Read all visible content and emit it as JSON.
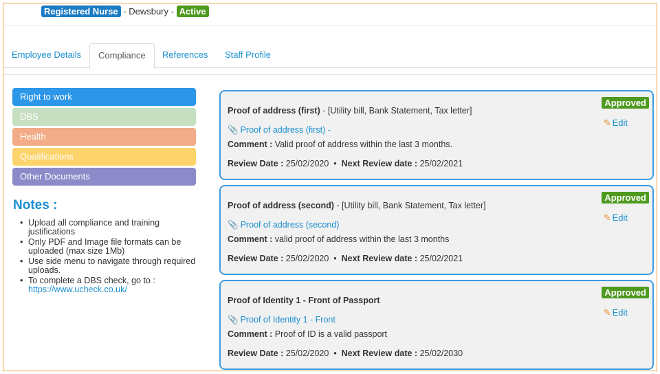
{
  "header": {
    "role": "Registered Nurse",
    "location_text": " - Dewsbury - ",
    "status": "Active"
  },
  "tabs": [
    {
      "label": "Employee Details",
      "active": false
    },
    {
      "label": "Compliance",
      "active": true
    },
    {
      "label": "References",
      "active": false
    },
    {
      "label": "Staff Profile",
      "active": false
    }
  ],
  "side_menu": [
    {
      "label": "Right to work",
      "color": "#2c96e8"
    },
    {
      "label": "DBS",
      "color": "#c5dfc0"
    },
    {
      "label": "Health",
      "color": "#f2ac87"
    },
    {
      "label": "Qualifications",
      "color": "#fdd36b"
    },
    {
      "label": "Other Documents",
      "color": "#8d8ac9"
    }
  ],
  "notes": {
    "title": "Notes :",
    "items": [
      "Upload all compliance and training justifications",
      "Only PDF and Image file formats can be uploaded (max size 1Mb)",
      "Use side menu to navigate through required uploads."
    ],
    "dbs_text": "To complete a DBS check, go to :",
    "dbs_link": "https://www.ucheck.co.uk/"
  },
  "labels": {
    "comment": "Comment :",
    "review_date": "Review Date :",
    "separator": "•",
    "next_review": "Next Review date :",
    "edit": "Edit",
    "paperclip_icon": "paperclip-icon",
    "pencil_icon": "pencil-icon"
  },
  "documents": [
    {
      "title_bold": "Proof of address (first)",
      "title_rest": " - [Utility bill, Bank Statement, Tax letter]",
      "status": "Approved",
      "link": "Proof of address (first) -",
      "comment": "Valid proof of address within the last 3 months.",
      "review_date": "25/02/2020",
      "next_review_date": "25/02/2021"
    },
    {
      "title_bold": "Proof of address (second)",
      "title_rest": " - [Utility bill, Bank Statement, Tax letter]",
      "status": "Approved",
      "link": "Proof of address (second)",
      "comment": "valid proof of address within the last 3 months",
      "review_date": "25/02/2020",
      "next_review_date": "25/02/2021"
    },
    {
      "title_bold": "Proof of Identity 1 - Front of Passport",
      "title_rest": "",
      "status": "Approved",
      "link": "Proof of Identity 1 - Front",
      "comment": "Proof of ID is a valid passport",
      "review_date": "25/02/2020",
      "next_review_date": "25/02/2030"
    }
  ]
}
